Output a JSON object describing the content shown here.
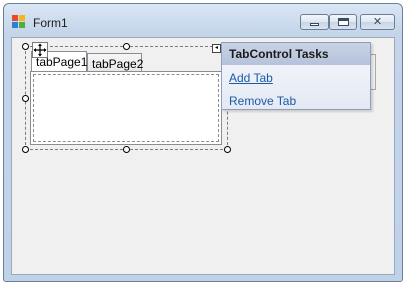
{
  "window": {
    "title": "Form1",
    "icon": "winforms-app-icon",
    "buttons": {
      "minimize": "minimize-icon",
      "maximize": "maximize-icon",
      "close": "✕"
    }
  },
  "tab_control": {
    "tabs": [
      {
        "label": "tabPage1",
        "selected": true
      },
      {
        "label": "tabPage2",
        "selected": false
      }
    ]
  },
  "smart_tag": {
    "glyph": "◂"
  },
  "tasks_panel": {
    "title": "TabControl Tasks",
    "actions": [
      {
        "label": "Add Tab"
      },
      {
        "label": "Remove Tab"
      }
    ]
  },
  "colors": {
    "title_bar": "#c4d5ea",
    "link": "#1c5aa6",
    "panel_header": "#b5c2da"
  }
}
